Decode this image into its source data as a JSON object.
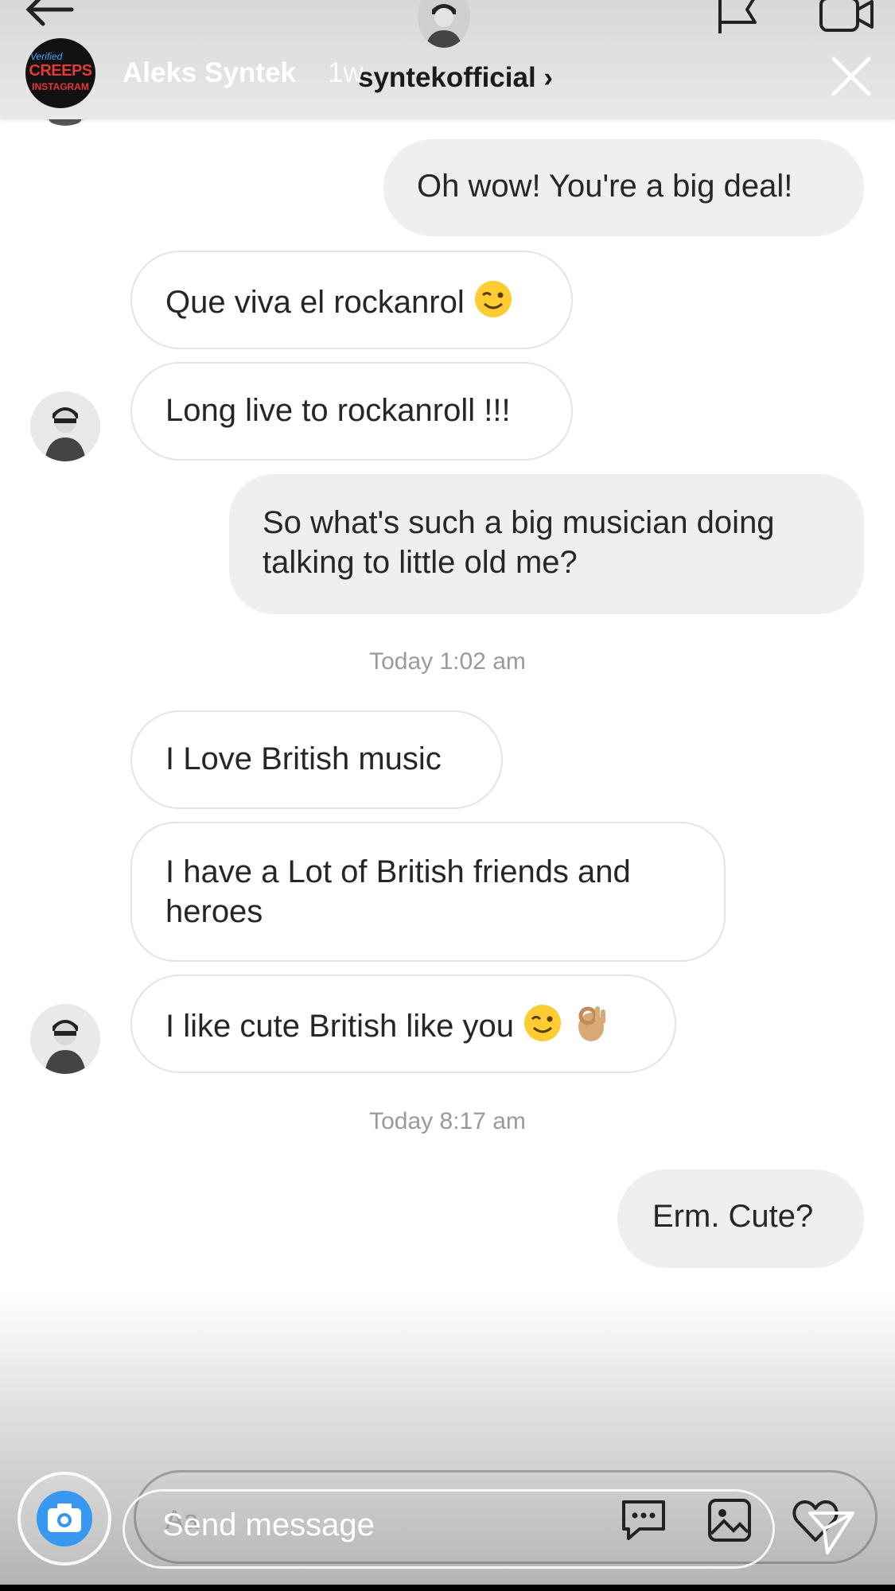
{
  "story_header": {
    "username": "Aleks Syntek",
    "time_ago": "1w",
    "avatar_text": {
      "top": "Verified",
      "middle": "CREEPS",
      "bottom": "INSTAGRAM"
    }
  },
  "dm_header": {
    "username": "syntekofficial ›"
  },
  "messages": [
    {
      "side": "out",
      "lines": [
        "Oh wow!  You're a big deal!"
      ]
    },
    {
      "side": "in",
      "lines": [
        "Que viva el rockanrol"
      ],
      "emoji": [
        "wink"
      ]
    },
    {
      "side": "in",
      "lines": [
        "Long live to rockanroll !!!"
      ]
    },
    {
      "side": "out",
      "lines": [
        "So what's such a big musician doing",
        "talking to little old me?"
      ]
    },
    {
      "side": "in",
      "lines": [
        "I Love British music"
      ]
    },
    {
      "side": "in",
      "lines": [
        "I have  a Lot of British friends and",
        "heroes"
      ]
    },
    {
      "side": "in",
      "lines": [
        "I like cute British like you"
      ],
      "emoji": [
        "wink",
        "ok-hand"
      ]
    },
    {
      "side": "out",
      "lines": [
        "Erm.  Cute?"
      ]
    }
  ],
  "timestamps": [
    "Today 1:02 am",
    "Today 8:17 am"
  ],
  "composer": {
    "hint": "Aa",
    "placeholder": "Send message"
  },
  "icons": {
    "back": "arrow-left-icon",
    "flag": "flag-icon",
    "video": "video-call-icon",
    "close": "close-icon",
    "camera": "camera-icon",
    "chat": "message-bubble-icon",
    "gallery": "gallery-icon",
    "heart": "heart-icon",
    "send": "send-icon"
  },
  "colors": {
    "incoming_bubble": "#ffffff",
    "outgoing_bubble": "#efefef",
    "text": "#262626",
    "timestamp": "#9a9a9a",
    "camera_accent": "#3897f0"
  }
}
